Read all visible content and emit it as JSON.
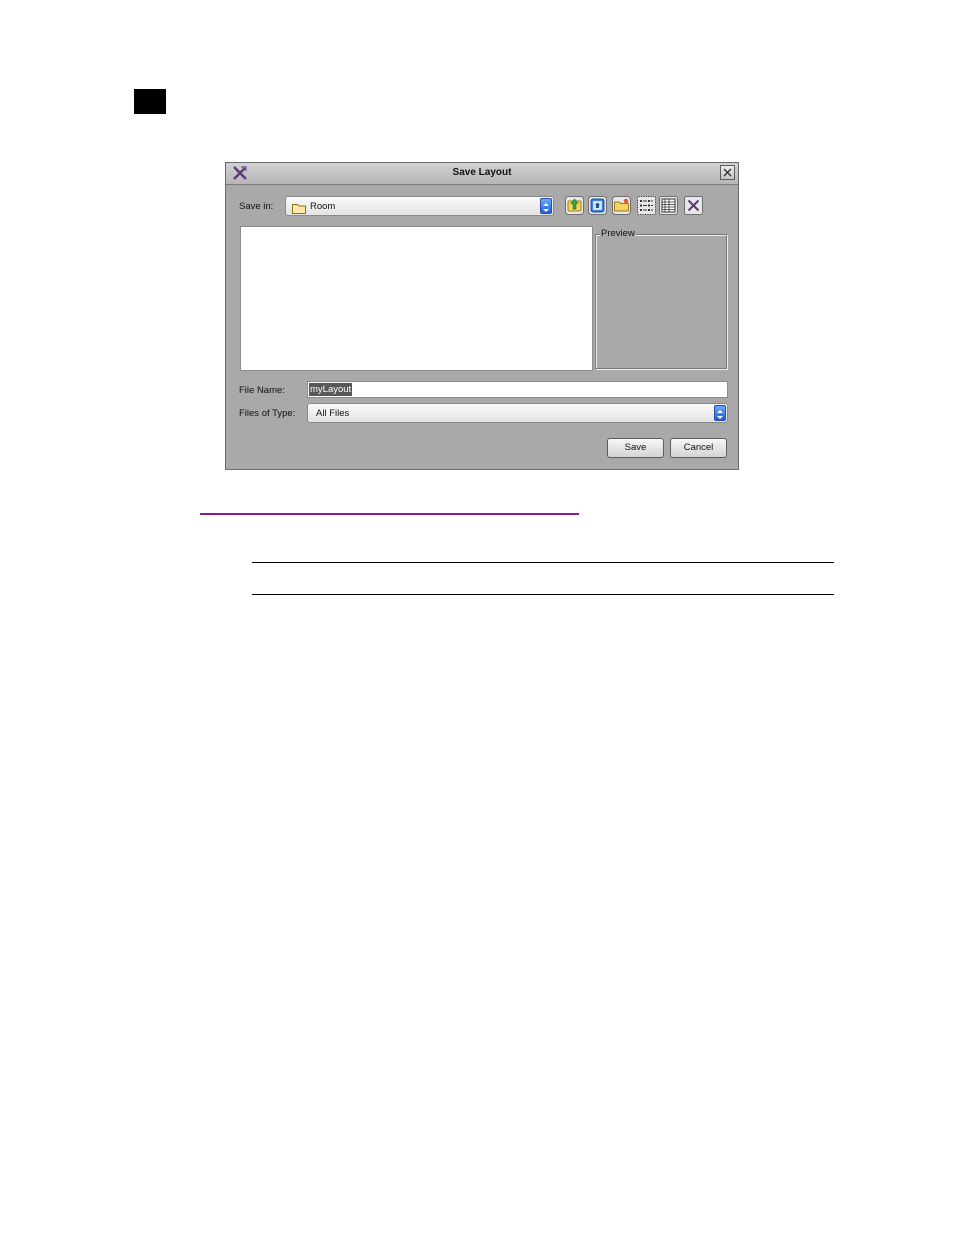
{
  "dialog": {
    "title": "Save Layout",
    "save_in": {
      "label": "Save in:",
      "value": "Room"
    },
    "toolbar": {
      "icons": [
        "up-folder-icon",
        "home-icon",
        "new-folder-icon",
        "list-view-icon",
        "details-view-icon",
        "delete-icon"
      ]
    },
    "preview": {
      "label": "Preview"
    },
    "file_name": {
      "label": "File Name:",
      "value": "myLayout"
    },
    "files_of_type": {
      "label": "Files of Type:",
      "value": "All Files"
    },
    "buttons": {
      "save": "Save",
      "cancel": "Cancel"
    }
  },
  "colors": {
    "dialog_bg": "#a9a9a9",
    "link_underline": "#8b1a8b",
    "combo_arrow": "#1f5fd8"
  }
}
